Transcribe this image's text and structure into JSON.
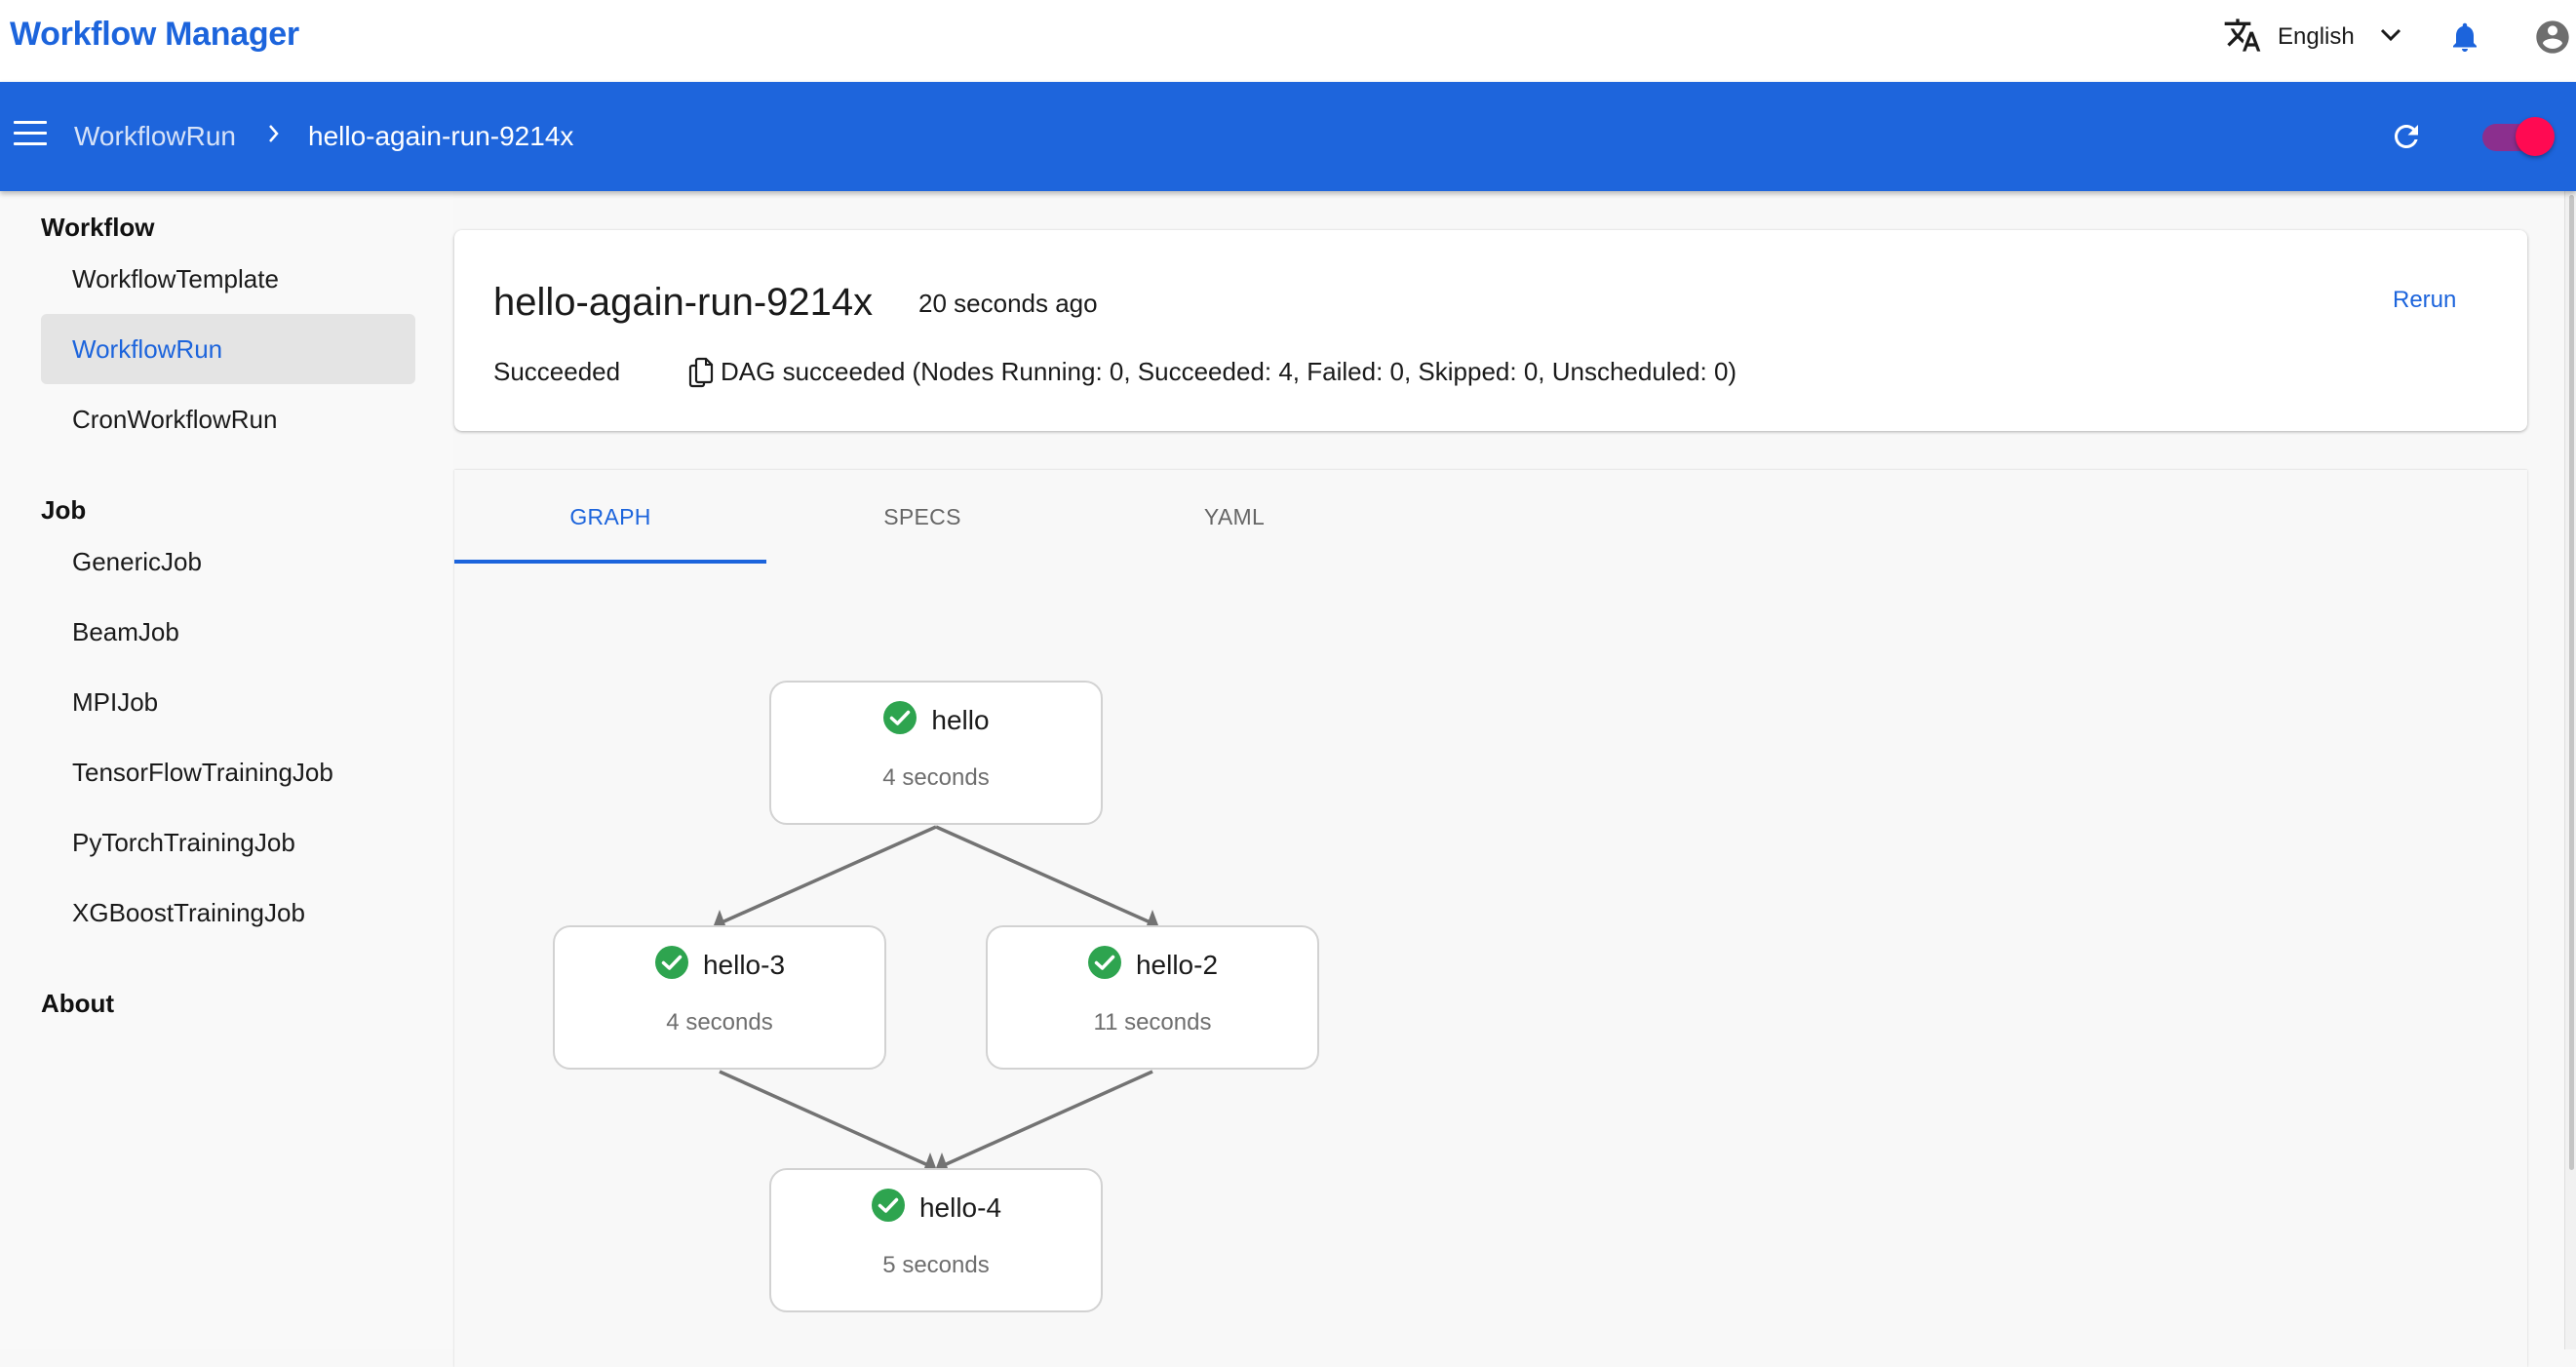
{
  "app": {
    "title": "Workflow Manager",
    "language": "English",
    "icons": {
      "translate": "translate-icon",
      "chevron": "chevron-down-icon",
      "bell": "bell-icon",
      "account": "account-circle-icon"
    }
  },
  "toolbar": {
    "breadcrumb": [
      "WorkflowRun",
      "hello-again-run-9214x"
    ],
    "toggle_on": true,
    "colors": {
      "bar": "#1e65dc",
      "toggle_thumb": "#ff0a52",
      "toggle_track": "#8b2f8e"
    }
  },
  "sidebar": {
    "sections": [
      {
        "header": "Workflow",
        "items": [
          "WorkflowTemplate",
          "WorkflowRun",
          "CronWorkflowRun"
        ]
      },
      {
        "header": "Job",
        "items": [
          "GenericJob",
          "BeamJob",
          "MPIJob",
          "TensorFlowTrainingJob",
          "PyTorchTrainingJob",
          "XGBoostTrainingJob"
        ]
      },
      {
        "header": "About",
        "items": []
      }
    ],
    "active_item": "WorkflowRun"
  },
  "summary": {
    "name": "hello-again-run-9214x",
    "age": "20 seconds ago",
    "rerun_label": "Rerun",
    "status": "Succeeded",
    "message": "DAG succeeded (Nodes Running: 0, Succeeded: 4, Failed: 0, Skipped: 0, Unscheduled: 0)"
  },
  "tabs": [
    {
      "label": "GRAPH",
      "active": true
    },
    {
      "label": "SPECS",
      "active": false
    },
    {
      "label": "YAML",
      "active": false
    }
  ],
  "graph": {
    "nodes": [
      {
        "id": "hello",
        "name": "hello",
        "duration": "4 seconds",
        "status": "succeeded"
      },
      {
        "id": "hello-3",
        "name": "hello-3",
        "duration": "4 seconds",
        "status": "succeeded"
      },
      {
        "id": "hello-2",
        "name": "hello-2",
        "duration": "11 seconds",
        "status": "succeeded"
      },
      {
        "id": "hello-4",
        "name": "hello-4",
        "duration": "5 seconds",
        "status": "succeeded"
      }
    ],
    "edges": [
      {
        "from": "hello",
        "to": "hello-3"
      },
      {
        "from": "hello",
        "to": "hello-2"
      },
      {
        "from": "hello-3",
        "to": "hello-4"
      },
      {
        "from": "hello-2",
        "to": "hello-4"
      }
    ],
    "status_color": "#2ea44f"
  }
}
